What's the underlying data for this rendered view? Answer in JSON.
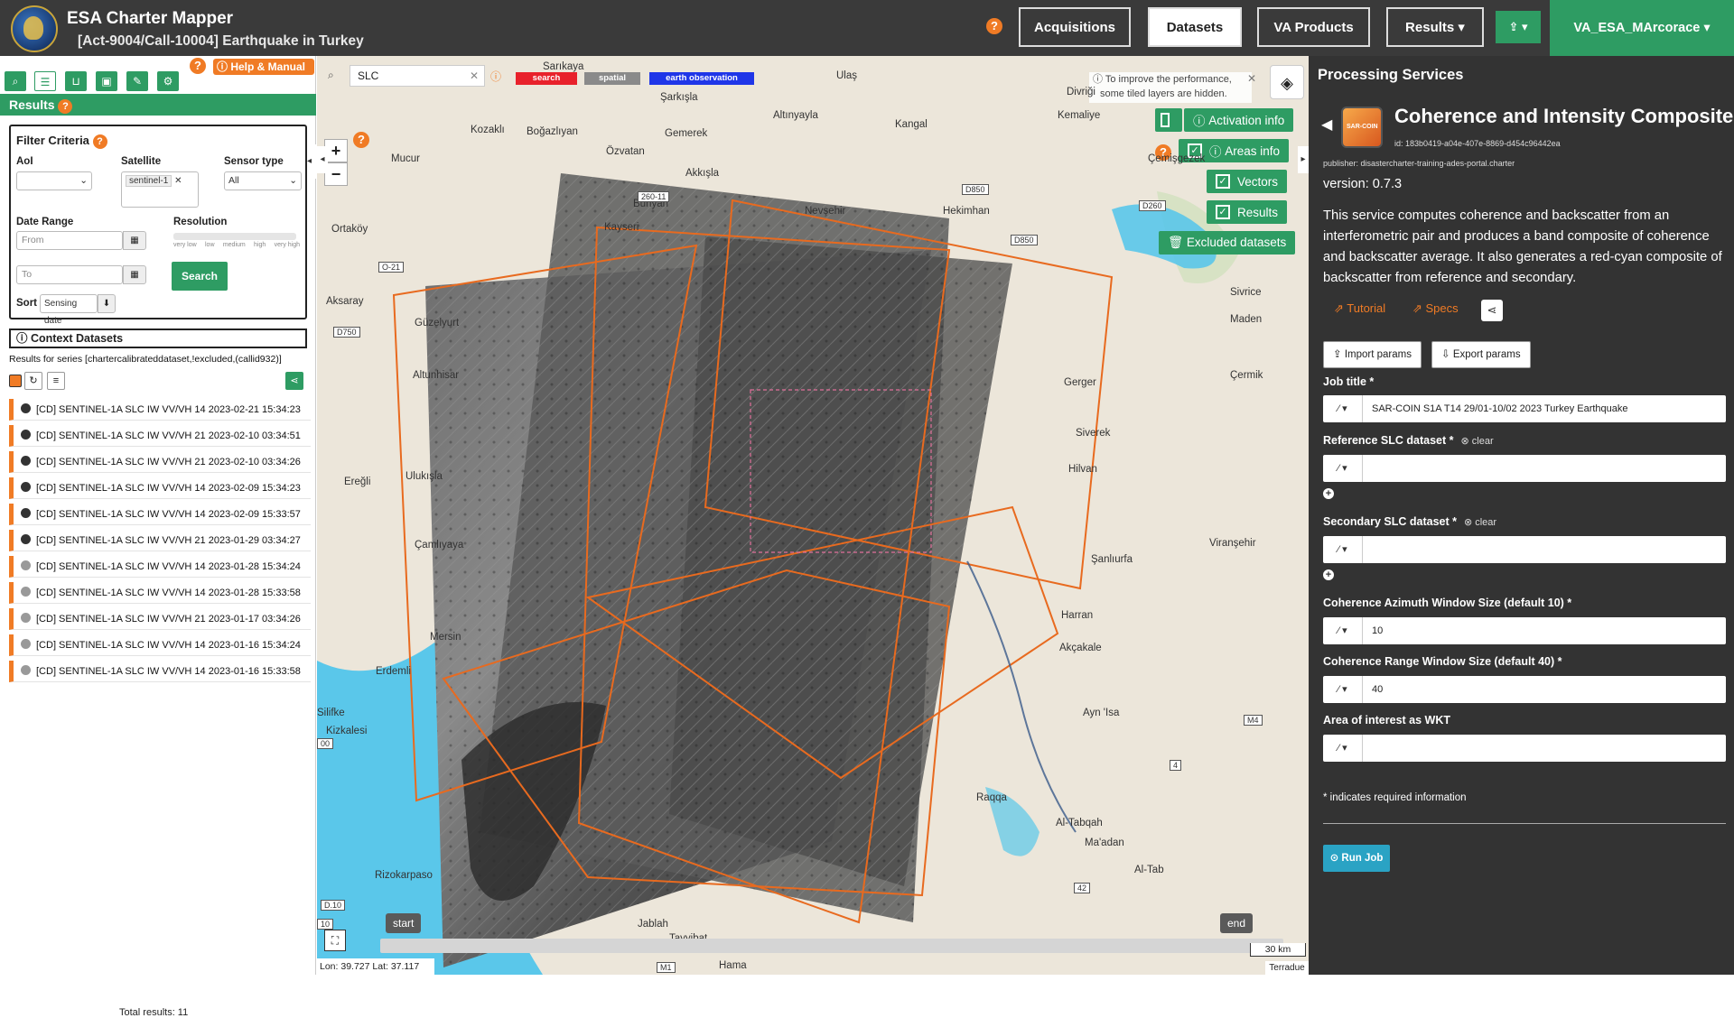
{
  "header": {
    "app_title": "ESA Charter Mapper",
    "subtitle": "[Act-9004/Call-10004] Earthquake in Turkey",
    "help": "?",
    "tabs": [
      {
        "label": "Acquisitions",
        "active": false
      },
      {
        "label": "Datasets",
        "active": true
      },
      {
        "label": "VA Products",
        "active": false
      },
      {
        "label": "Results ▾",
        "active": false
      }
    ],
    "upload_label": "⇪ ▾",
    "user": "VA_ESA_MArcorace ▾"
  },
  "left": {
    "help_manual": "ⓘ Help & Manual",
    "results_title": "Results",
    "filter": {
      "title": "Filter Criteria",
      "aoi_label": "AoI",
      "satellite_label": "Satellite",
      "satellite_value": "sentinel-1",
      "sensor_label": "Sensor type",
      "sensor_value": "All",
      "date_label": "Date Range",
      "from_placeholder": "From",
      "to_placeholder": "To",
      "resolution_label": "Resolution",
      "res_ticks": [
        "very low",
        "low",
        "medium",
        "high",
        "very high"
      ],
      "sort_label": "Sort",
      "sort_value": "Sensing date",
      "search_button": "Search"
    },
    "context_title": "ⓘ Context Datasets",
    "series_text": "Results for series [chartercalibrateddataset,!excluded,(callid932)]",
    "items": [
      {
        "text": "[CD] SENTINEL-1A SLC IW VV/VH 14 2023-02-21 15:34:23",
        "grey": false
      },
      {
        "text": "[CD] SENTINEL-1A SLC IW VV/VH 21 2023-02-10 03:34:51",
        "grey": false
      },
      {
        "text": "[CD] SENTINEL-1A SLC IW VV/VH 21 2023-02-10 03:34:26",
        "grey": false
      },
      {
        "text": "[CD] SENTINEL-1A SLC IW VV/VH 14 2023-02-09 15:34:23",
        "grey": false
      },
      {
        "text": "[CD] SENTINEL-1A SLC IW VV/VH 14 2023-02-09 15:33:57",
        "grey": false
      },
      {
        "text": "[CD] SENTINEL-1A SLC IW VV/VH 21 2023-01-29 03:34:27",
        "grey": false
      },
      {
        "text": "[CD] SENTINEL-1A SLC IW VV/VH 14 2023-01-28 15:34:24",
        "grey": true
      },
      {
        "text": "[CD] SENTINEL-1A SLC IW VV/VH 14 2023-01-28 15:33:58",
        "grey": true
      },
      {
        "text": "[CD] SENTINEL-1A SLC IW VV/VH 21 2023-01-17 03:34:26",
        "grey": true
      },
      {
        "text": "[CD] SENTINEL-1A SLC IW VV/VH 14 2023-01-16 15:34:24",
        "grey": true
      },
      {
        "text": "[CD] SENTINEL-1A SLC IW VV/VH 14 2023-01-16 15:33:58",
        "grey": true
      }
    ],
    "total": "Total results: 11"
  },
  "map": {
    "search_value": "SLC",
    "tags": [
      "search",
      "spatial",
      "earth observation"
    ],
    "perf_note_1": "ⓘ To improve the performance,",
    "perf_note_2": "some tiled layers are hidden.",
    "toggles": [
      "Activation info",
      "Areas info",
      "Vectors",
      "Results"
    ],
    "excluded": "🗑 Excluded datasets",
    "labels": [
      "Sarıkaya",
      "Ulaş",
      "Divriği",
      "Şarkışla",
      "Altınyayla",
      "Kemaliye",
      "Kangal",
      "Kozaklı",
      "Boğazlıyan",
      "Gemerek",
      "Özvatan",
      "Mucur",
      "Akkışla",
      "Bünyan",
      "Kayseri",
      "Nevşehir",
      "Hekimhan",
      "Çemişgezek",
      "Ortaköy",
      "Aksaray",
      "Güzelyurt",
      "Altunhisar",
      "Ereğli",
      "Ulukışla",
      "Çamlıyaya",
      "Mersin",
      "Erdemli",
      "Silifke",
      "Kizkalesi",
      "Rizokarpaso",
      "Jablah",
      "Tayyibat",
      "Hama",
      "Raqqa",
      "Al-Tabqah",
      "Ma'adan",
      "Al-Tab",
      "Akçakale",
      "Ayn 'Isa",
      "Harran",
      "Şanlıurfa",
      "Viranşehir",
      "Hilvan",
      "Siverek",
      "Gerger",
      "Çermik",
      "Maden",
      "Sivrice",
      "Kizkalesi"
    ],
    "roads": [
      "260-11",
      "D850",
      "D260",
      "O-21",
      "D750",
      "D850",
      "M4",
      "4",
      "42",
      "D.10",
      "M1",
      "10",
      "00"
    ],
    "timeline_start": "start",
    "timeline_end": "end",
    "coords": "Lon: 39.727 Lat: 37.117",
    "scale": "30 km",
    "attribution": "Terradue"
  },
  "panel": {
    "title": "Processing Services",
    "service_name": "Coherence and Intensity Composite",
    "icon_text": "SAR-COIN",
    "service_id": "id: 183b0419-a04e-407e-8869-d454c96442ea",
    "publisher": "publisher: disastercharter-training-ades-portal.charter",
    "version": "version: 0.7.3",
    "description": "This service computes coherence and backscatter from an interferometric pair and produces a band composite of coherence and backscatter average. It also generates a red-cyan composite of backscatter from reference and secondary.",
    "tutorial": "⇗ Tutorial",
    "specs": "⇗ Specs",
    "import": "⇪ Import params",
    "export": "⇩ Export params",
    "fields": [
      {
        "label": "Job title *",
        "clear": "",
        "value": "SAR-COIN S1A T14 29/01-10/02 2023 Turkey Earthquake"
      },
      {
        "label": "Reference SLC dataset *",
        "clear": "⊗ clear",
        "value": ""
      },
      {
        "label": "Secondary SLC dataset *",
        "clear": "⊗ clear",
        "value": ""
      },
      {
        "label": "Coherence Azimuth Window Size (default 10) *",
        "clear": "",
        "value": "10"
      },
      {
        "label": "Coherence Range Window Size (default 40) *",
        "clear": "",
        "value": "40"
      },
      {
        "label": "Area of interest as WKT",
        "clear": "",
        "value": ""
      }
    ],
    "required_note": "* indicates required information",
    "run": "⊙ Run Job"
  },
  "colors": {
    "green": "#2e9c63",
    "orange": "#f07b25",
    "dark": "#3a3a3a",
    "panel": "#333333",
    "sea": "#5ac7ea",
    "footprint": "#e86a1f"
  }
}
